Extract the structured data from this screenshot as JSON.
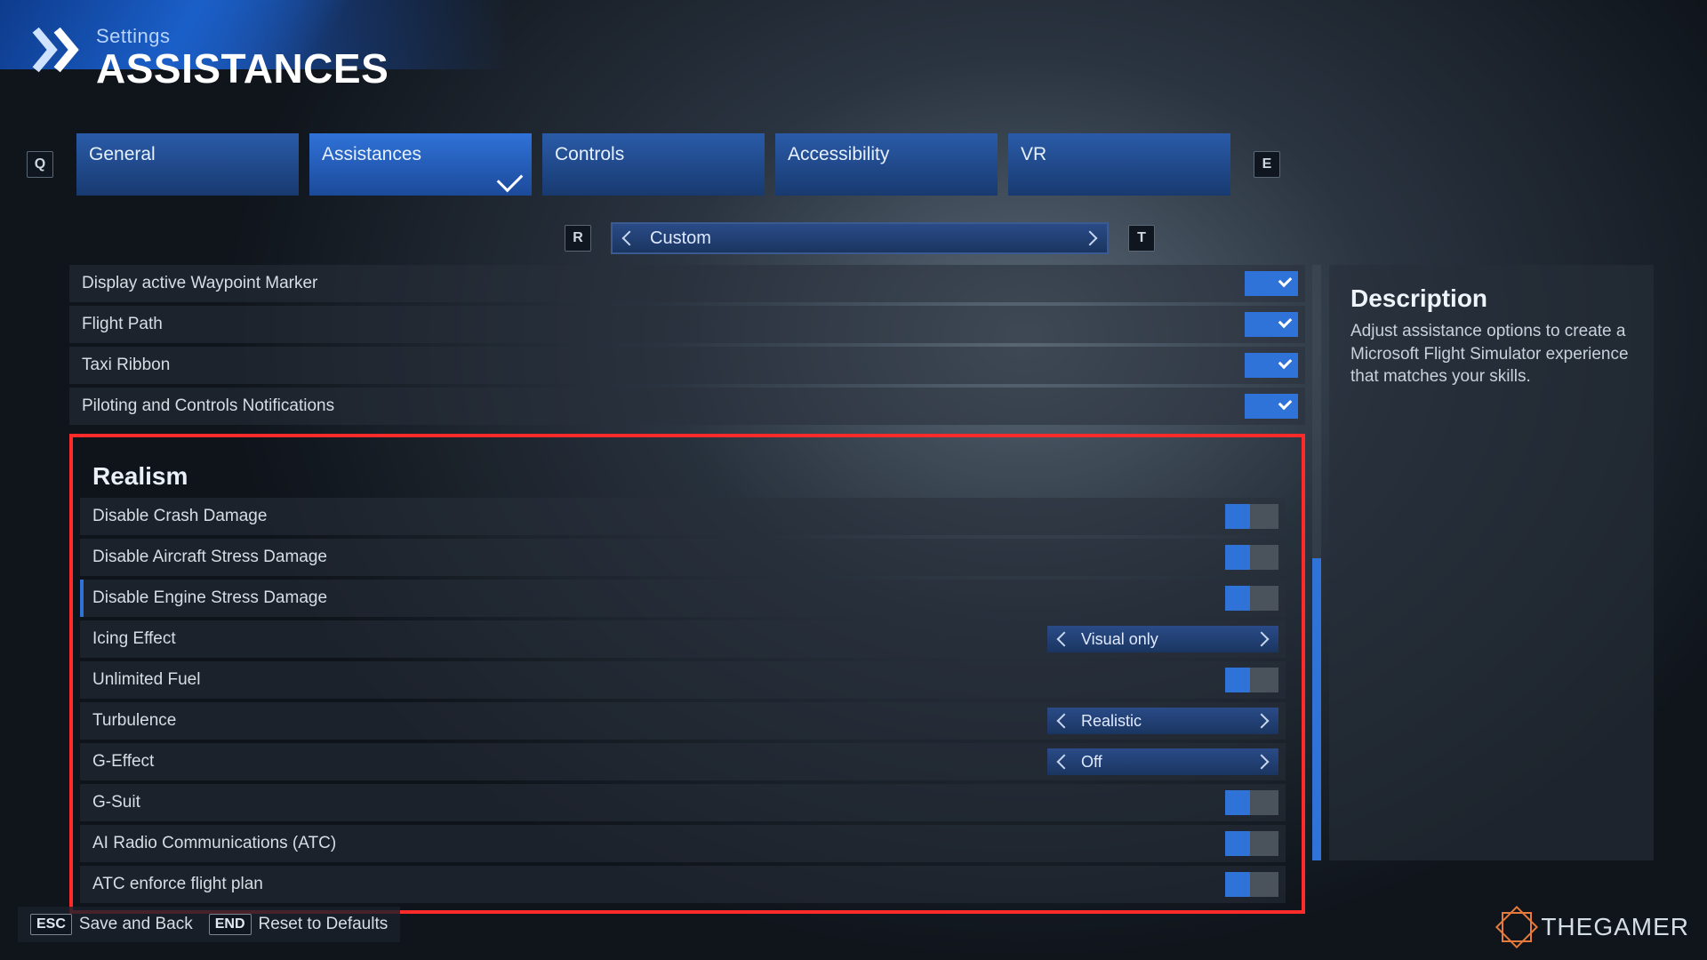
{
  "header": {
    "sub": "Settings",
    "title": "ASSISTANCES"
  },
  "tabrow": {
    "left_key": "Q",
    "right_key": "E",
    "tabs": [
      "General",
      "Assistances",
      "Controls",
      "Accessibility",
      "VR"
    ],
    "active_index": 1
  },
  "preset": {
    "left_key": "R",
    "right_key": "T",
    "value": "Custom"
  },
  "pre_rows": [
    {
      "label": "Display active Waypoint Marker",
      "type": "check",
      "value": true
    },
    {
      "label": "Flight Path",
      "type": "check",
      "value": true
    },
    {
      "label": "Taxi Ribbon",
      "type": "check",
      "value": true
    },
    {
      "label": "Piloting and Controls Notifications",
      "type": "check",
      "value": true
    }
  ],
  "section": {
    "title": "Realism",
    "rows": [
      {
        "label": "Disable Crash Damage",
        "type": "toggle",
        "value": "off"
      },
      {
        "label": "Disable Aircraft Stress Damage",
        "type": "toggle",
        "value": "off"
      },
      {
        "label": "Disable Engine Stress Damage",
        "type": "toggle",
        "value": "off"
      },
      {
        "label": "Icing Effect",
        "type": "select",
        "value": "Visual only"
      },
      {
        "label": "Unlimited Fuel",
        "type": "toggle",
        "value": "off"
      },
      {
        "label": "Turbulence",
        "type": "select",
        "value": "Realistic"
      },
      {
        "label": "G-Effect",
        "type": "select",
        "value": "Off"
      },
      {
        "label": "G-Suit",
        "type": "toggle",
        "value": "off"
      },
      {
        "label": "AI Radio Communications (ATC)",
        "type": "toggle",
        "value": "off"
      },
      {
        "label": "ATC enforce flight plan",
        "type": "toggle",
        "value": "off"
      }
    ]
  },
  "description": {
    "title": "Description",
    "body": "Adjust assistance options to create a Microsoft Flight Simulator experience that matches your skills."
  },
  "footer": {
    "esc_key": "ESC",
    "esc_label": "Save and Back",
    "end_key": "END",
    "end_label": "Reset to Defaults"
  },
  "logo": "THEGAMER"
}
